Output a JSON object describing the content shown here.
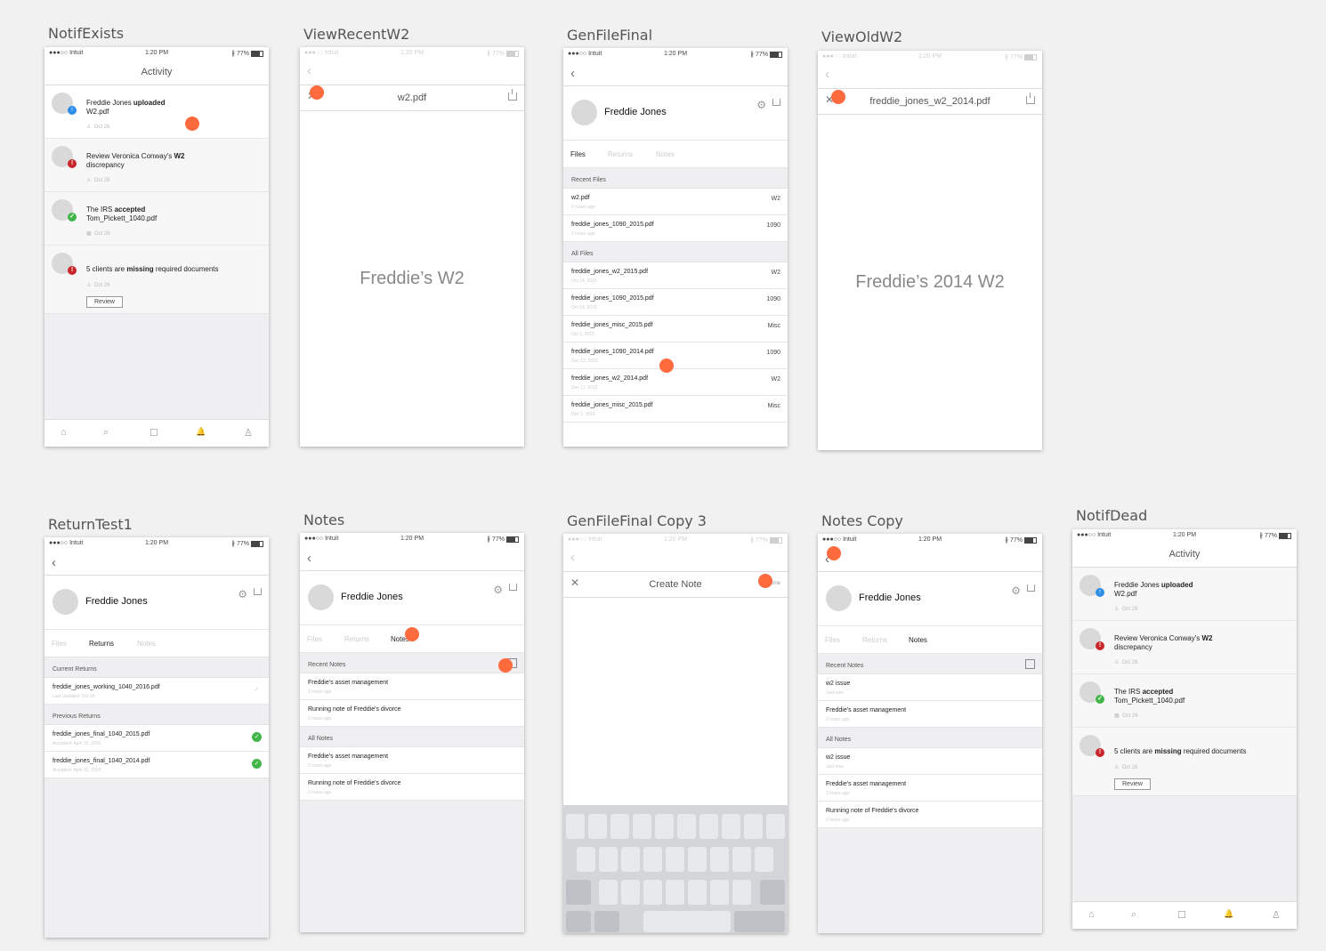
{
  "status": {
    "carrier": "●●●○○ Intuit",
    "time": "1:20 PM",
    "battery": "∦ 77%"
  },
  "artboards": {
    "a1": "NotifExists",
    "a2": "ViewRecentW2",
    "a3": "GenFileFinal",
    "a4": "ViewOldW2",
    "a5": "ReturnTest1",
    "a6": "Notes",
    "a7": "GenFileFinal Copy 3",
    "a8": "Notes Copy",
    "a9": "NotifDead"
  },
  "activity": {
    "title": "Activity",
    "n1_pre": "Freddie Jones ",
    "n1_bold": "uploaded",
    "n1_post": "W2.pdf",
    "n2_pre": "Review Veronica Conway's ",
    "n2_bold": "W2",
    "n2_post": "discrepancy",
    "n3_pre": "The IRS ",
    "n3_bold": "accepted",
    "n3_post": "Tom_Pickett_1040.pdf",
    "n4_pre": "5 clients are ",
    "n4_bold": "missing",
    "n4_post": " required documents",
    "date": "Oct 26",
    "review": "Review",
    "badge_up": "↑",
    "badge_bang": "!",
    "badge_check": "✓"
  },
  "doc": {
    "w2_title": "w2.pdf",
    "w2_body": "Freddie’s W2",
    "old_title": "freddie_jones_w2_2014.pdf",
    "old_body": "Freddie’s 2014 W2"
  },
  "client": {
    "name": "Freddie Jones",
    "tab_files": "Files",
    "tab_returns": "Returns",
    "tab_notes": "Notes"
  },
  "files": {
    "recent_head": "Recent Files",
    "all_head": "All Files",
    "recent": [
      {
        "name": "w2.pdf",
        "sub": "2 hours ago",
        "tag": "W2"
      },
      {
        "name": "freddie_jones_1090_2015.pdf",
        "sub": "2 hours ago",
        "tag": "1090"
      }
    ],
    "all": [
      {
        "name": "freddie_jones_w2_2015.pdf",
        "sub": "Oct 14, 2015",
        "tag": "W2"
      },
      {
        "name": "freddie_jones_1090_2015.pdf",
        "sub": "Oct 14, 2015",
        "tag": "1090"
      },
      {
        "name": "freddie_jones_misc_2015.pdf",
        "sub": "Oct 1, 2015",
        "tag": "Misc"
      },
      {
        "name": "freddie_jones_1090_2014.pdf",
        "sub": "Dec 12, 2015",
        "tag": "1090"
      },
      {
        "name": "freddie_jones_w2_2014.pdf",
        "sub": "Dec 11, 2015",
        "tag": "W2"
      },
      {
        "name": "freddie_jones_misc_2015.pdf",
        "sub": "Dec 1, 2015",
        "tag": "Misc"
      }
    ]
  },
  "returns": {
    "current_head": "Current Returns",
    "previous_head": "Previous Returns",
    "current": {
      "name": "freddie_jones_working_1040_2016.pdf",
      "sub": "Last Updated: Oct 14"
    },
    "previous": [
      {
        "name": "freddie_jones_final_1040_2015.pdf",
        "sub": "Accepted: April 15, 2015"
      },
      {
        "name": "freddie_jones_final_1040_2014.pdf",
        "sub": "Accepted: April 16, 2014"
      }
    ],
    "check": "✓"
  },
  "notes": {
    "recent_head": "Recent Notes",
    "all_head": "All Notes",
    "asset": "Freddie's asset management",
    "divorce": "Running note of Freddie's divorce",
    "w2issue": "w2 issue",
    "ago": "2 hours ago",
    "justnow": "Just now"
  },
  "create_note": {
    "title": "Create Note",
    "done": "Done"
  },
  "icons": {
    "back": "‹",
    "close": "✕",
    "gear": "⚙",
    "home": "⌂",
    "search": "⌕",
    "square": "☐",
    "bell": "🔔",
    "person": "♙",
    "calendar": "▦",
    "user": "♙"
  }
}
